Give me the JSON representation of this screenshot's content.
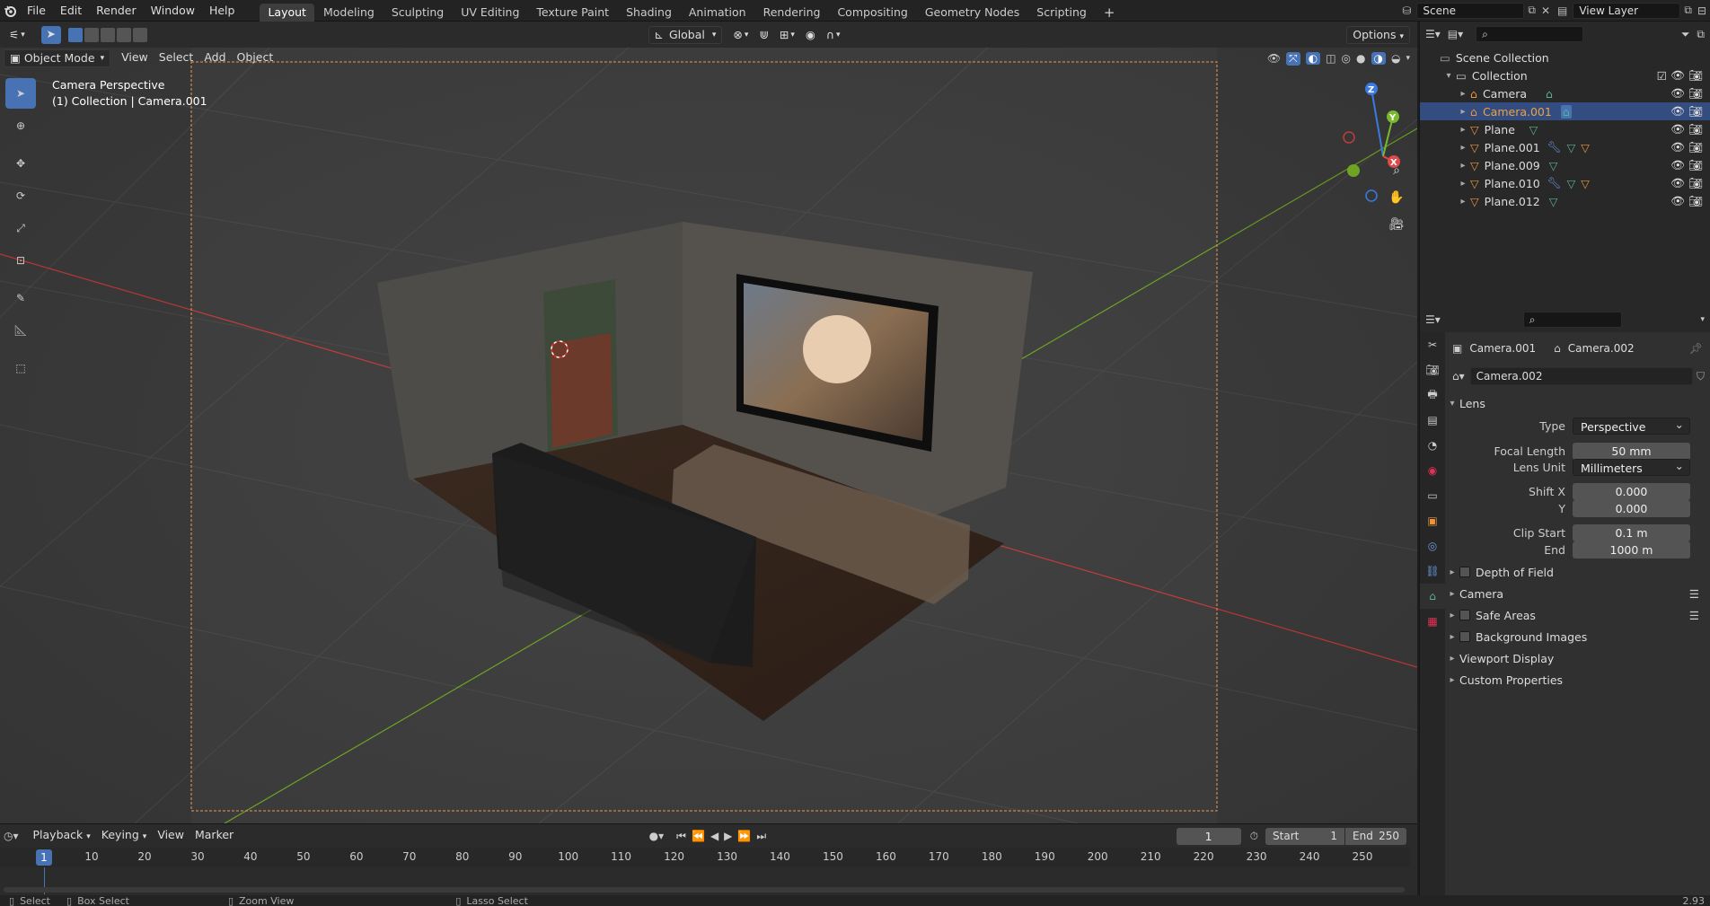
{
  "top_menu": [
    "File",
    "Edit",
    "Render",
    "Window",
    "Help"
  ],
  "workspace_tabs": [
    "Layout",
    "Modeling",
    "Sculpting",
    "UV Editing",
    "Texture Paint",
    "Shading",
    "Animation",
    "Rendering",
    "Compositing",
    "Geometry Nodes",
    "Scripting"
  ],
  "active_workspace": "Layout",
  "scene_name": "Scene",
  "view_layer": "View Layer",
  "viewport_header": {
    "mode": "Object Mode",
    "menus": [
      "View",
      "Select",
      "Add",
      "Object"
    ],
    "transform_orientation": "Global",
    "options": "Options"
  },
  "viewport_overlay": {
    "title": "Camera Perspective",
    "subtitle": "(1) Collection | Camera.001"
  },
  "outliner": {
    "root": "Scene Collection",
    "collection": "Collection",
    "items": [
      {
        "name": "Camera",
        "selected": false
      },
      {
        "name": "Camera.001",
        "selected": true
      },
      {
        "name": "Plane",
        "selected": false
      },
      {
        "name": "Plane.001",
        "selected": false
      },
      {
        "name": "Plane.009",
        "selected": false
      },
      {
        "name": "Plane.010",
        "selected": false
      },
      {
        "name": "Plane.012",
        "selected": false
      }
    ]
  },
  "properties": {
    "breadcrumb_object": "Camera.001",
    "breadcrumb_data": "Camera.002",
    "datablock_name": "Camera.002",
    "lens_panel": "Lens",
    "type_label": "Type",
    "type_value": "Perspective",
    "focal_label": "Focal Length",
    "focal_value": "50 mm",
    "lens_unit_label": "Lens Unit",
    "lens_unit_value": "Millimeters",
    "shift_x_label": "Shift X",
    "shift_x_value": "0.000",
    "shift_y_label": "Y",
    "shift_y_value": "0.000",
    "clip_start_label": "Clip Start",
    "clip_start_value": "0.1 m",
    "clip_end_label": "End",
    "clip_end_value": "1000 m",
    "panels": [
      "Depth of Field",
      "Camera",
      "Safe Areas",
      "Background Images",
      "Viewport Display",
      "Custom Properties"
    ]
  },
  "timeline": {
    "menus": [
      "Playback",
      "Keying",
      "View",
      "Marker"
    ],
    "current_frame": "1",
    "start_label": "Start",
    "start_value": "1",
    "end_label": "End",
    "end_value": "250",
    "ticks": [
      "1",
      "10",
      "20",
      "30",
      "40",
      "50",
      "60",
      "70",
      "80",
      "90",
      "100",
      "110",
      "120",
      "130",
      "140",
      "150",
      "160",
      "170",
      "180",
      "190",
      "200",
      "210",
      "220",
      "230",
      "240",
      "250"
    ]
  },
  "statusbar": {
    "select": "Select",
    "box_select": "Box Select",
    "zoom_view": "Zoom View",
    "lasso_select": "Lasso Select",
    "version": "2.93"
  },
  "colors": {
    "accent_blue": "#4772b3",
    "selection_blue": "#334d80",
    "camera_green": "#57b38a",
    "mesh_orange": "#e6953a",
    "x_axis_red": "#c43c3c",
    "y_axis_green": "#6fa323"
  }
}
